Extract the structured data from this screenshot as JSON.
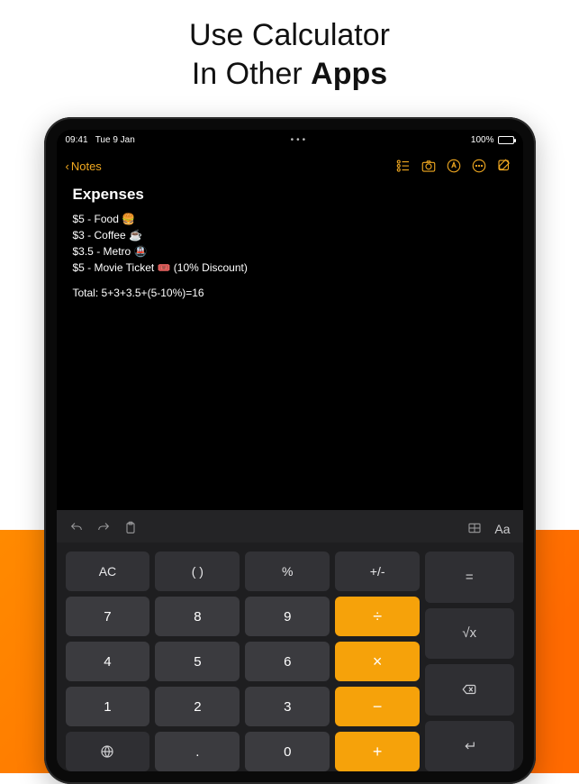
{
  "hero": {
    "line1_a": "Use Calculator",
    "line2_a": "In Other ",
    "line2_b": "Apps"
  },
  "statusbar": {
    "time": "09:41",
    "date": "Tue 9 Jan",
    "dots": "•••",
    "wifi": "᯾",
    "battery_pct": "100%"
  },
  "nav": {
    "back_chevron": "‹",
    "back_label": "Notes"
  },
  "note": {
    "title": "Expenses",
    "lines": [
      "$5 - Food 🍔",
      "$3 - Coffee ☕",
      "$3.5 - Metro 🚇",
      "$5 - Movie Ticket 🎟️ (10% Discount)"
    ],
    "total": "Total: 5+3+3.5+(5-10%)=16"
  },
  "kb_toolbar": {
    "aa": "Aa"
  },
  "calc": {
    "row0": {
      "ac": "AC",
      "paren": "( )",
      "pct": "%",
      "pm": "+/-"
    },
    "row1": {
      "k7": "7",
      "k8": "8",
      "k9": "9",
      "div": "÷"
    },
    "row2": {
      "k4": "4",
      "k5": "5",
      "k6": "6",
      "mul": "×"
    },
    "row3": {
      "k1": "1",
      "k2": "2",
      "k3": "3",
      "sub": "−"
    },
    "row4": {
      "dot": ".",
      "k0": "0",
      "add": "+"
    },
    "side": {
      "eq": "=",
      "sqrt": "√x"
    }
  }
}
